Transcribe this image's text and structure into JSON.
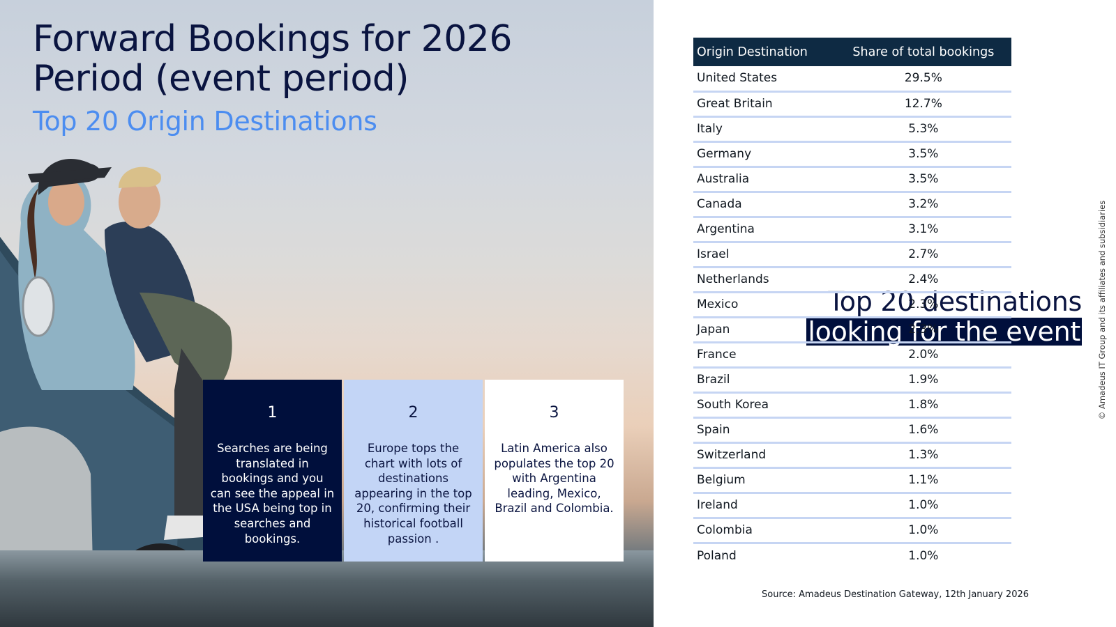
{
  "title": "Forward Bookings for 2026 Period (event period)",
  "subtitle": "Top 20 Origin Destinations",
  "headline": {
    "line1": "Top 20 destinations",
    "line2": "looking for the event"
  },
  "cards": [
    {
      "number": "1",
      "text": "Searches are being translated in bookings and you can see the appeal in the USA being top in searches and bookings."
    },
    {
      "number": "2",
      "text": "Europe tops the chart with lots of destinations appearing in the top 20, confirming their historical football passion ."
    },
    {
      "number": "3",
      "text": "Latin America also populates the top 20 with Argentina leading, Mexico, Brazil and Colombia."
    }
  ],
  "table": {
    "headers": [
      "Origin Destination",
      "Share of total bookings"
    ],
    "rows": [
      {
        "country": "United States",
        "share": "29.5%"
      },
      {
        "country": "Great Britain",
        "share": "12.7%"
      },
      {
        "country": "Italy",
        "share": "5.3%"
      },
      {
        "country": "Germany",
        "share": "3.5%"
      },
      {
        "country": "Australia",
        "share": "3.5%"
      },
      {
        "country": "Canada",
        "share": "3.2%"
      },
      {
        "country": "Argentina",
        "share": "3.1%"
      },
      {
        "country": "Israel",
        "share": "2.7%"
      },
      {
        "country": "Netherlands",
        "share": "2.4%"
      },
      {
        "country": "Mexico",
        "share": "2.3%"
      },
      {
        "country": "Japan",
        "share": "2.3%"
      },
      {
        "country": "France",
        "share": "2.0%"
      },
      {
        "country": "Brazil",
        "share": "1.9%"
      },
      {
        "country": "South Korea",
        "share": "1.8%"
      },
      {
        "country": "Spain",
        "share": "1.6%"
      },
      {
        "country": "Switzerland",
        "share": "1.3%"
      },
      {
        "country": "Belgium",
        "share": "1.1%"
      },
      {
        "country": "Ireland",
        "share": "1.0%"
      },
      {
        "country": "Colombia",
        "share": "1.0%"
      },
      {
        "country": "Poland",
        "share": "1.0%"
      }
    ]
  },
  "source": "Source: Amadeus Destination Gateway, 12th January 2026",
  "copyright": "© Amadeus IT Group and its affiliates and subsidiaries",
  "colors": {
    "navy": "#000f3c",
    "accent_blue": "#4c8df0",
    "light_blue": "#c3d5f6",
    "table_header": "#0e2a43"
  }
}
